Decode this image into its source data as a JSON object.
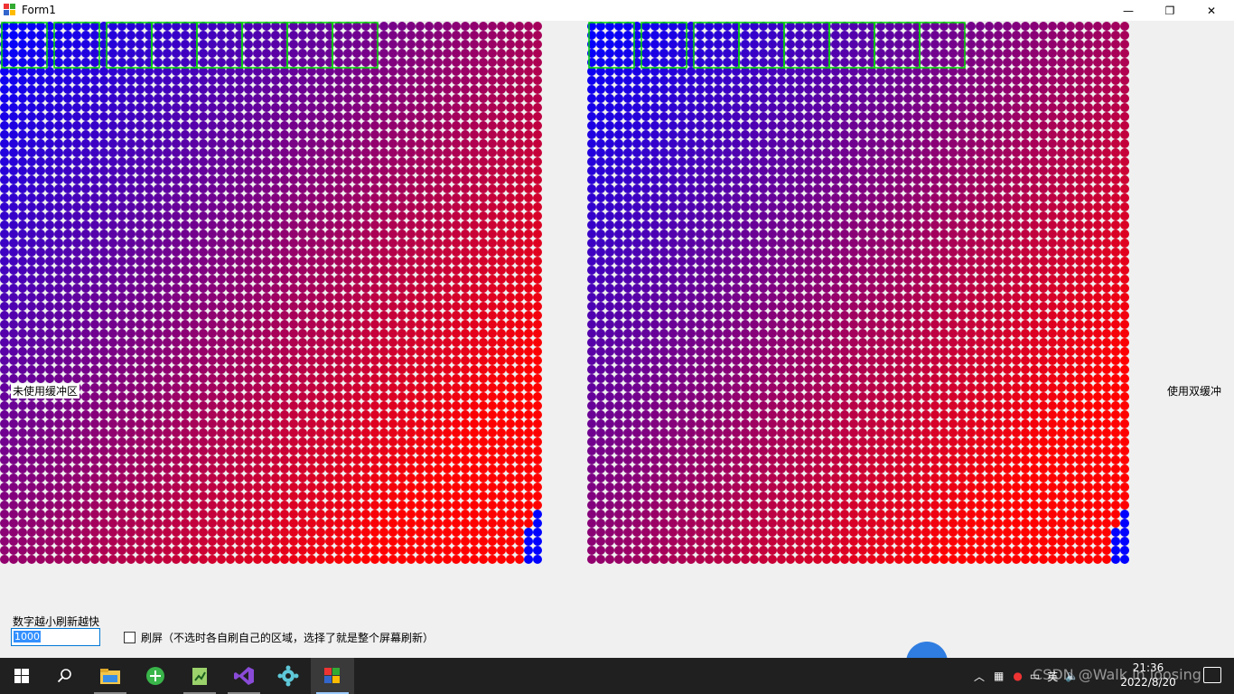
{
  "window": {
    "title": "Form1"
  },
  "controls": {
    "minimize": "—",
    "maximize": "❐",
    "close": "✕"
  },
  "labels": {
    "left_panel": "未使用缓冲区",
    "right_panel": "使用双缓冲",
    "speed_hint": "数字越小刷新越快",
    "speed_value": "1000",
    "refresh_checkbox": "刷屏（不选时各自刷自己的区域，选择了就是整个屏幕刷新）"
  },
  "panels": {
    "grid_count": 60,
    "color_start": "#0000ff",
    "color_end": "#ff0000",
    "highlight_color": "#00dd00",
    "highlight_boxes": 8
  },
  "taskbar": {
    "apps": [
      "windows-start-icon",
      "search-icon",
      "file-explorer-icon",
      "browser-icon",
      "notepad-icon",
      "visual-studio-icon",
      "settings-gear-icon",
      "form-app-icon"
    ],
    "tray_text": "英",
    "time": "21:36",
    "date": "2022/8/20",
    "watermark": "CSDN @Walk in loosing"
  }
}
